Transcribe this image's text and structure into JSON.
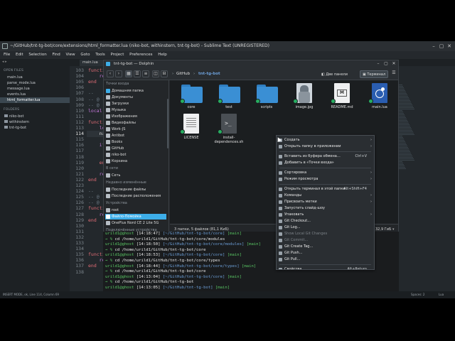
{
  "sublime": {
    "title": "~/GitHub/tnt-tg-bot/core/extensions/html_formatter.lua (niko-bot, withinstern, tnt-tg-bot) - Sublime Text (UNREGISTERED)",
    "menu": [
      "File",
      "Edit",
      "Selection",
      "Find",
      "View",
      "Goto",
      "Tools",
      "Project",
      "Preferences",
      "Help"
    ],
    "tab": "main.lua",
    "open_files_head": "OPEN FILES",
    "open_files": [
      "main.lua",
      "parse_mode.lua",
      "message.lua",
      "events.lua",
      "html_formatter.lua"
    ],
    "folders_head": "FOLDERS",
    "folders": [
      "niko-bot",
      "withinstern",
      "tnt-tg-bot"
    ],
    "line_numbers": [
      "103",
      "104",
      "105",
      "106",
      "107",
      "108",
      "109",
      "110",
      "111",
      "112",
      "113",
      "114",
      "115",
      "116",
      "117",
      "118",
      "119",
      "120",
      "121",
      "122",
      "123",
      "124",
      "125",
      "126",
      "127",
      "128",
      "129",
      "130",
      "131",
      "132",
      "133",
      "134",
      "135",
      "136",
      "137",
      "138"
    ],
    "code_lines": [
      "function",
      "    ret",
      "end",
      "",
      "--",
      "-- @",
      "-- @",
      "local",
      "",
      "function",
      "    loca",
      "    name",
      "",
      "    if",
      "",
      "",
      "    end",
      "",
      "    ret",
      "end",
      "",
      "--",
      "-- @",
      "-- @",
      "functi",
      "    ret",
      "end",
      "",
      "",
      "",
      "",
      "",
      "function",
      "    ret",
      "end",
      ""
    ],
    "status_left": "INSERT MODE, ok, Line 114, Column 69",
    "status_spaces": "Spaces: 2",
    "status_lang": "Lua"
  },
  "dolphin": {
    "title": "tnt-tg-bot — Dolphin",
    "breadcrumb": [
      "GitHub",
      "tnt-tg-bot"
    ],
    "split_label": "Две панели",
    "terminal_label": "Терминал",
    "places_head": "Точки входа",
    "places": [
      "Домашняя папка",
      "Документы",
      "Загрузки",
      "Музыка",
      "Изображения",
      "Видеофайлы",
      "Work-JS",
      "Antibot",
      "Books",
      "GitHub",
      "niko-bot",
      "Корзина"
    ],
    "remote_head": "В сети",
    "remote": [
      "Сеть"
    ],
    "recent_head": "Недавно изменённые",
    "recent": [
      "Последние файлы",
      "Последние расположения"
    ],
    "devices_head": "Устройства",
    "devices": [
      "root",
      "Файло-Помойка",
      "OnePlus Nord CE 2 Lite 5G"
    ],
    "connected_head": "Подключённые устройства",
    "files": [
      {
        "name": "core",
        "kind": "folder"
      },
      {
        "name": "test",
        "kind": "folder"
      },
      {
        "name": "scripts",
        "kind": "folder"
      },
      {
        "name": "image.jpg",
        "kind": "image"
      },
      {
        "name": "README.md",
        "kind": "markdown"
      },
      {
        "name": "main.lua",
        "kind": "lua"
      },
      {
        "name": "LICENSE",
        "kind": "text"
      },
      {
        "name": "install-dependences.sh",
        "kind": "script"
      }
    ],
    "status_text": "3 папки, 5 файлов (81,1 КиБ)",
    "zoom": "32,9 ГиБ"
  },
  "terminal": {
    "lines": [
      {
        "user": "urild1@ghost",
        "time": "[14:18:47]",
        "path": "[~/GitHub/tnt-tg-bot/core]",
        "branch": "[main]"
      },
      {
        "cmd": "cd /home/urild1/GitHub/tnt-tg-bot/core/modules"
      },
      {
        "user": "urild1@ghost",
        "time": "[14:18:50]",
        "path": "[~/GitHub/tnt-tg-bot/core/modules]",
        "branch": "[main]"
      },
      {
        "cmd": "cd /home/urild1/GitHub/tnt-tg-bot/core"
      },
      {
        "user": "urild1@ghost",
        "time": "[14:18:53]",
        "path": "[~/GitHub/tnt-tg-bot/core]",
        "branch": "[main]"
      },
      {
        "cmd": "cd /home/urild1/GitHub/tnt-tg-bot/core/types"
      },
      {
        "user": "urild1@ghost",
        "time": "[14:18:44]",
        "path": "[~/GitHub/tnt-tg-bot/core/types]",
        "branch": "[main]"
      },
      {
        "cmd": "cd /home/urild1/GitHub/tnt-tg-bot/core"
      },
      {
        "user": "urild1@ghost",
        "time": "[14:13:04]",
        "path": "[~/GitHub/tnt-tg-bot/core]",
        "branch": "[main]"
      },
      {
        "cmd": "cd /home/urild1/GitHub/tnt-tg-bot"
      },
      {
        "user": "urild1@ghost",
        "time": "[14:13:05]",
        "path": "[~/GitHub/tnt-tg-bot]",
        "branch": "[main]"
      },
      {
        "cmd": ""
      }
    ],
    "arrow": "→"
  },
  "context_menu": {
    "items": [
      {
        "label": "Создать",
        "sub": true
      },
      {
        "label": "Открыть папку в приложении",
        "sub": true
      },
      {
        "sep": true
      },
      {
        "label": "Вставить из буфера обмена…",
        "shortcut": "Ctrl+V"
      },
      {
        "label": "Добавить в «Точки входа»"
      },
      {
        "sep": true
      },
      {
        "label": "Сортировка",
        "sub": true
      },
      {
        "label": "Режим просмотра",
        "sub": true
      },
      {
        "sep": true
      },
      {
        "label": "Открыть терминал в этой папке",
        "shortcut": "Alt+Shift+F4"
      },
      {
        "label": "Команды",
        "sub": true
      },
      {
        "label": "Присвоить метки",
        "sub": true
      },
      {
        "label": "Запустить слайд-шоу"
      },
      {
        "label": "Упаковать",
        "sub": true
      },
      {
        "label": "Git Checkout..."
      },
      {
        "label": "Git Log..."
      },
      {
        "label": "Show Local Git Changes",
        "disabled": true
      },
      {
        "label": "Git Commit...",
        "disabled": true
      },
      {
        "label": "Git Create Tag..."
      },
      {
        "label": "Git Push..."
      },
      {
        "label": "Git Pull..."
      },
      {
        "sep": true
      },
      {
        "label": "Свойства",
        "shortcut": "Alt+Return"
      }
    ]
  }
}
